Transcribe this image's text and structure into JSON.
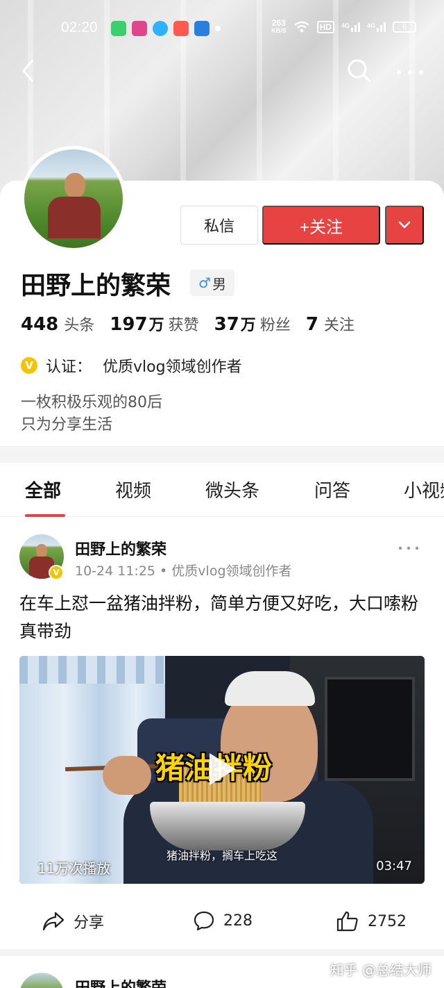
{
  "status_bar": {
    "time": "02:20",
    "net_speed": "263",
    "net_unit": "KB/S",
    "hd_label": "HD",
    "signal1": "4G",
    "signal2": "4G",
    "battery": "6"
  },
  "profile": {
    "name": "田野上的繁荣",
    "gender_symbol": "♂",
    "gender_label": "男",
    "message_button": "私信",
    "follow_button": "+关注",
    "stats": [
      {
        "num": "448",
        "unit": "",
        "label": "头条"
      },
      {
        "num": "197",
        "unit": "万",
        "label": "获赞"
      },
      {
        "num": "37",
        "unit": "万",
        "label": "粉丝"
      },
      {
        "num": "7",
        "unit": "",
        "label": "关注"
      }
    ],
    "verify_badge": "V",
    "verify_label": "认证：",
    "verify_text": "优质vlog领域创作者",
    "bio_line1": "一枚积极乐观的80后",
    "bio_line2": "只为分享生活"
  },
  "tabs": [
    "全部",
    "视频",
    "微头条",
    "问答",
    "小视频"
  ],
  "post": {
    "author": "田野上的繁荣",
    "verify_badge": "V",
    "meta": "10-24 11:25 • 优质vlog领域创作者",
    "text": "在车上怼一盆猪油拌粉，简单方便又好吃，大口嗦粉真带劲",
    "video": {
      "title_overlay": "猪油拌粉",
      "subtitle": "猪油拌粉，搁车上吃这",
      "plays": "11万次播放",
      "duration": "03:47"
    },
    "actions": {
      "share": "分享",
      "comments": "228",
      "likes": "2752"
    }
  },
  "post2": {
    "author": "田野上的繁荣"
  },
  "watermark": "知乎 @总结大师",
  "colors": {
    "accent_red": "#e84343",
    "verify_yellow": "#f5c400",
    "gender_blue": "#3a8be6"
  }
}
